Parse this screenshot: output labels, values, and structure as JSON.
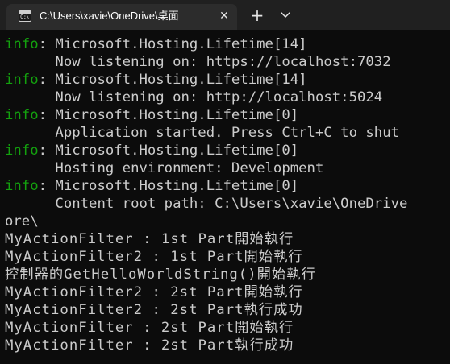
{
  "tab": {
    "icon": "terminal-icon",
    "icon_glyph": "C:\\",
    "title": "C:\\Users\\xavie\\OneDrive\\桌面",
    "close_glyph": "✕"
  },
  "toolbar": {
    "new_tab_glyph": "+",
    "dropdown_icon": "chevron-down-icon"
  },
  "colors": {
    "background": "#0c0c0c",
    "text": "#cccccc",
    "info_level": "#13a10e",
    "tabbar": "#202020",
    "active_tab": "#2c2c2c"
  },
  "console": {
    "lines": [
      {
        "level": "info",
        "text": ": Microsoft.Hosting.Lifetime[14]"
      },
      {
        "level": "",
        "text": "      Now listening on: https://localhost:7032"
      },
      {
        "level": "info",
        "text": ": Microsoft.Hosting.Lifetime[14]"
      },
      {
        "level": "",
        "text": "      Now listening on: http://localhost:5024"
      },
      {
        "level": "info",
        "text": ": Microsoft.Hosting.Lifetime[0]"
      },
      {
        "level": "",
        "text": "      Application started. Press Ctrl+C to shut"
      },
      {
        "level": "info",
        "text": ": Microsoft.Hosting.Lifetime[0]"
      },
      {
        "level": "",
        "text": "      Hosting environment: Development"
      },
      {
        "level": "info",
        "text": ": Microsoft.Hosting.Lifetime[0]"
      },
      {
        "level": "",
        "text": "      Content root path: C:\\Users\\xavie\\OneDrive"
      },
      {
        "level": "",
        "text": "ore\\"
      },
      {
        "level": "",
        "text": "MyActionFilter : 1st Part開始執行"
      },
      {
        "level": "",
        "text": "MyActionFilter2 : 1st Part開始執行"
      },
      {
        "level": "",
        "text": "控制器的GetHelloWorldString()開始執行"
      },
      {
        "level": "",
        "text": "MyActionFilter2 : 2st Part開始執行"
      },
      {
        "level": "",
        "text": "MyActionFilter2 : 2st Part執行成功"
      },
      {
        "level": "",
        "text": "MyActionFilter : 2st Part開始執行"
      },
      {
        "level": "",
        "text": "MyActionFilter : 2st Part執行成功"
      }
    ]
  }
}
